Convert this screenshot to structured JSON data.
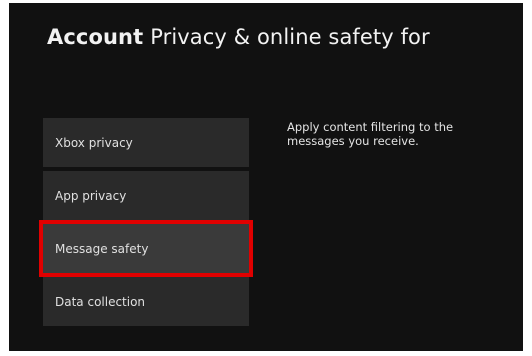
{
  "header": {
    "section": "Account",
    "title": "Privacy & online safety for"
  },
  "menu": {
    "items": [
      {
        "label": "Xbox privacy"
      },
      {
        "label": "App privacy"
      },
      {
        "label": "Message safety"
      },
      {
        "label": "Data collection"
      }
    ],
    "selected_index": 2
  },
  "description": "Apply content filtering to the messages you receive.",
  "colors": {
    "background": "#111111",
    "tile": "#2a2a2a",
    "highlight_outline": "#e00000"
  }
}
